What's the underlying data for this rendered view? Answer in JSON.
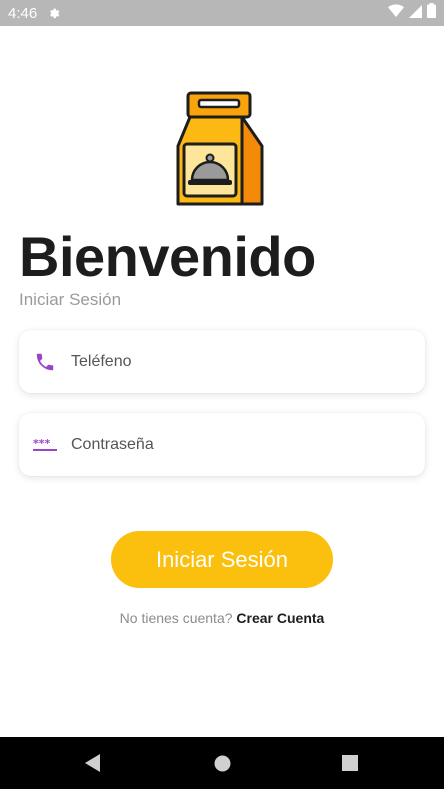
{
  "status_bar": {
    "time": "4:46",
    "icons": [
      "settings-icon",
      "wifi-icon",
      "signal-icon",
      "battery-icon"
    ]
  },
  "logo": {
    "icon": "food-bag-icon"
  },
  "header": {
    "title": "Bienvenido",
    "subtitle": "Iniciar Sesión"
  },
  "form": {
    "phone": {
      "placeholder": "Teléfeno",
      "value": "",
      "icon": "phone-icon"
    },
    "password": {
      "placeholder": "Contraseña",
      "value": "",
      "icon": "password-icon"
    },
    "submit_label": "Iniciar Sesión"
  },
  "signup": {
    "prompt": "No tienes cuenta?",
    "link_label": "Crear Cuenta"
  },
  "nav_bar": {
    "buttons": [
      "back-icon",
      "home-icon",
      "recent-apps-icon"
    ]
  },
  "colors": {
    "accent": "#fbbf0e",
    "icon_purple": "#9c44c8",
    "title": "#1d1d1d",
    "status_bar": "#b7b7b7"
  }
}
